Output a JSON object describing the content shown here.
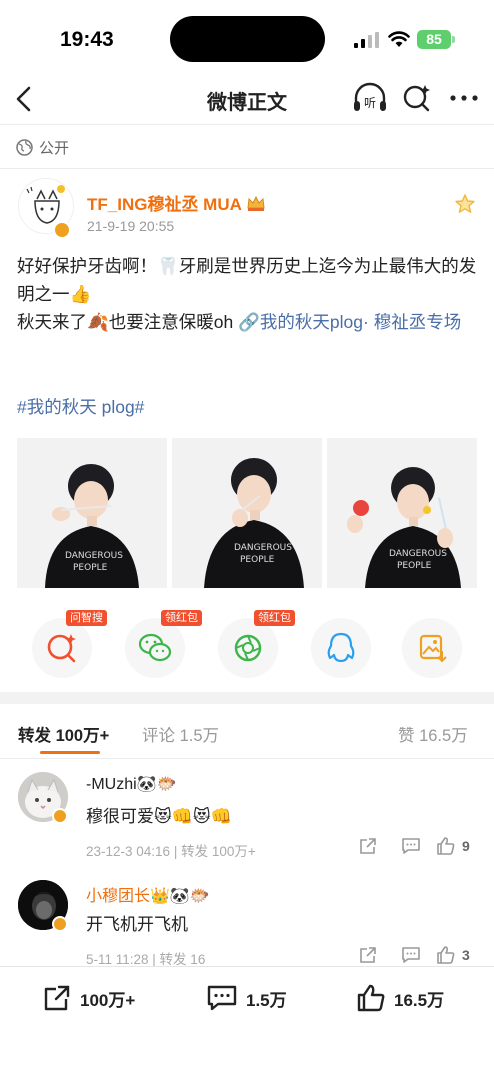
{
  "status_bar": {
    "time": "19:43",
    "battery": "85"
  },
  "nav": {
    "title": "微博正文",
    "listen_label": "听"
  },
  "visibility": {
    "label": "公开"
  },
  "post": {
    "username": "TF_ING穆祉丞 MUA",
    "time": "21-9-19 20:55",
    "text_line1": "好好保护牙齿啊！🦷牙刷是世界历史上迄今为止最伟大的发明之一👍",
    "text_line2_prefix": "秋天来了🍂也要注意保暖oh ",
    "link_text": "🔗我的秋天plog· 穆祉丞专场",
    "hashtag": "#我的秋天 plog#",
    "photo_count": 3
  },
  "share_actions": [
    {
      "name": "问智搜",
      "tag": "问智搜",
      "icon": "search-ai-icon"
    },
    {
      "name": "微信",
      "tag": "领红包",
      "icon": "wechat-icon"
    },
    {
      "name": "朋友圈",
      "tag": "领红包",
      "icon": "moments-icon"
    },
    {
      "name": "QQ",
      "tag": "",
      "icon": "qq-icon"
    },
    {
      "name": "保存图片",
      "tag": "",
      "icon": "save-image-icon"
    }
  ],
  "tabs": {
    "repost": "转发 100万+",
    "comment": "评论 1.5万",
    "like": "赞 16.5万"
  },
  "comments": [
    {
      "name": "-MUzhi🐼🐡",
      "text": "穆很可爱😻👊😻👊",
      "meta": "23-12-3 04:16 | 转发 100万+",
      "likes": "9",
      "name_color": "#333333"
    },
    {
      "name": "小穆团长👑🐼🐡",
      "text": "开飞机开飞机",
      "meta": "5-11 11:28 | 转发 16",
      "likes": "3",
      "name_color": "#f06f0e"
    }
  ],
  "bottom_bar": {
    "repost": "100万+",
    "comment": "1.5万",
    "like": "16.5万"
  },
  "colors": {
    "accent": "#f06f0e",
    "link": "#4a6ea8",
    "red_tag": "#f0502e"
  }
}
